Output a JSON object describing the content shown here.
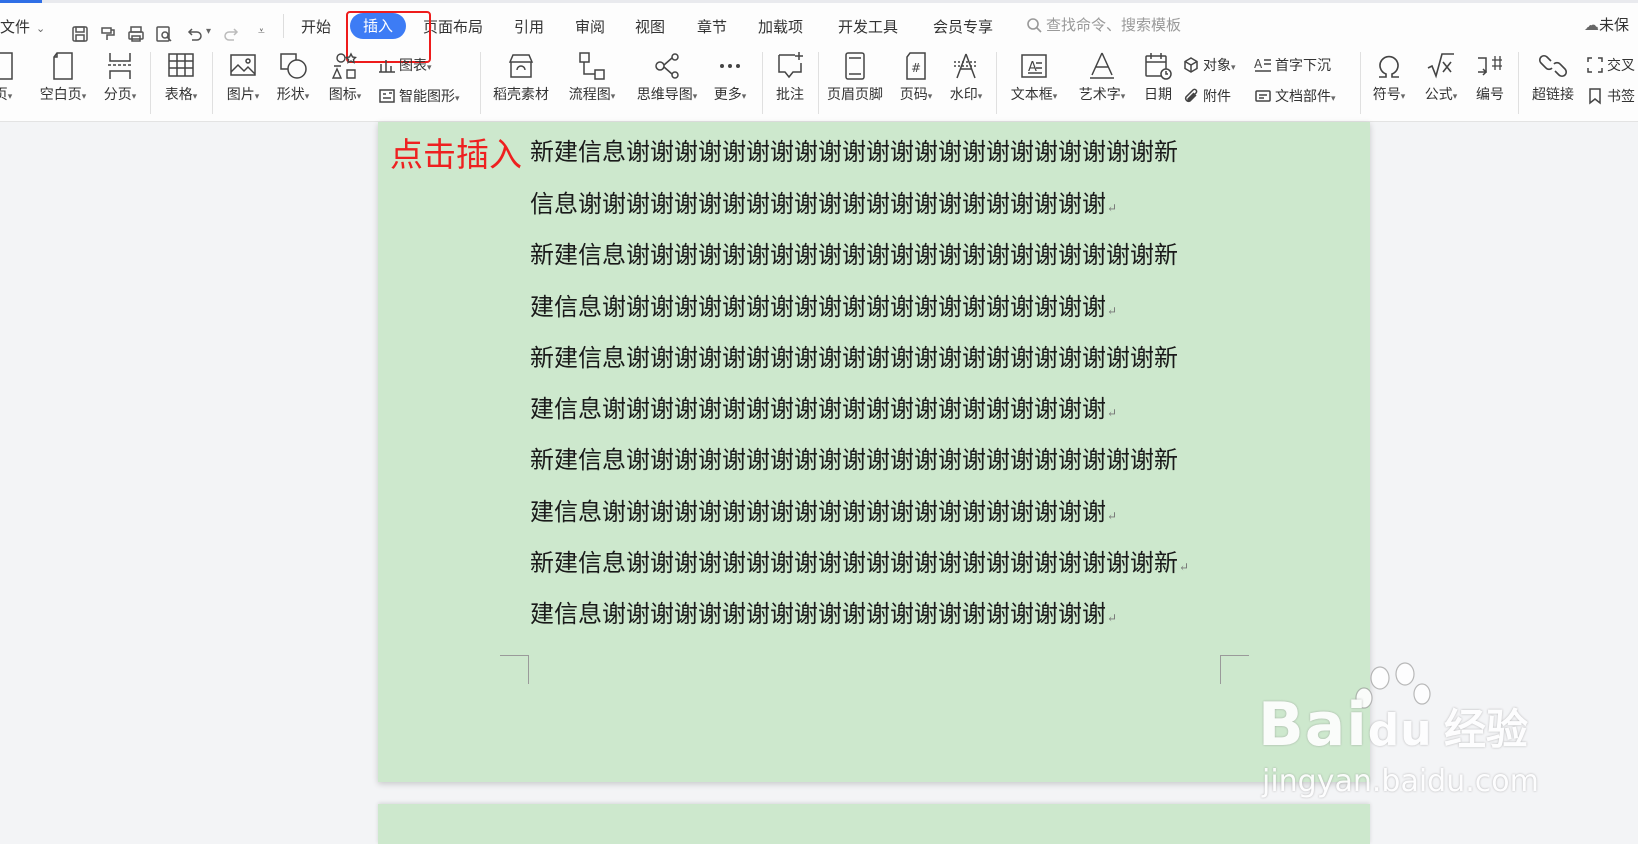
{
  "menu": {
    "file": "文件",
    "tabs": [
      "开始",
      "插入",
      "页面布局",
      "引用",
      "审阅",
      "视图",
      "章节",
      "加载项",
      "开发工具",
      "会员专享"
    ],
    "active_tab": "插入",
    "search_placeholder": "查找命令、搜索模板",
    "right_status": "未保"
  },
  "ribbon": {
    "cover_partial": "页",
    "blank_page": "空白页",
    "page_break": "分页",
    "table": "表格",
    "picture": "图片",
    "shape": "形状",
    "icon": "图标",
    "chart": "图表",
    "smart_shape": "智能图形",
    "shell_material": "稻壳素材",
    "flowchart": "流程图",
    "mindmap": "思维导图",
    "more": "更多",
    "comment": "批注",
    "header_footer": "页眉页脚",
    "page_number": "页码",
    "watermark": "水印",
    "text_box": "文本框",
    "word_art": "艺术字",
    "date": "日期",
    "object": "对象",
    "attachment": "附件",
    "drop_cap": "首字下沉",
    "doc_parts": "文档部件",
    "symbol": "符号",
    "formula": "公式",
    "numbering": "编号",
    "hyperlink": "超链接",
    "cross_ref_partial": "交叉",
    "bookmark": "书签"
  },
  "document": {
    "annotation": "点击插入",
    "lines": [
      "新建信息谢谢谢谢谢谢谢谢谢谢谢谢谢谢谢谢谢谢谢谢谢谢新",
      "信息谢谢谢谢谢谢谢谢谢谢谢谢谢谢谢谢谢谢谢谢谢谢",
      "新建信息谢谢谢谢谢谢谢谢谢谢谢谢谢谢谢谢谢谢谢谢谢谢新",
      "建信息谢谢谢谢谢谢谢谢谢谢谢谢谢谢谢谢谢谢谢谢谢",
      "新建信息谢谢谢谢谢谢谢谢谢谢谢谢谢谢谢谢谢谢谢谢谢谢新",
      "建信息谢谢谢谢谢谢谢谢谢谢谢谢谢谢谢谢谢谢谢谢谢",
      "新建信息谢谢谢谢谢谢谢谢谢谢谢谢谢谢谢谢谢谢谢谢谢谢新",
      "建信息谢谢谢谢谢谢谢谢谢谢谢谢谢谢谢谢谢谢谢谢谢",
      "新建信息谢谢谢谢谢谢谢谢谢谢谢谢谢谢谢谢谢谢谢谢谢谢新",
      "建信息谢谢谢谢谢谢谢谢谢谢谢谢谢谢谢谢谢谢谢谢谢"
    ]
  },
  "watermark": {
    "brand": "Bai",
    "brand2": "du",
    "jingyan": "经验",
    "url": "jingyan.baidu.com"
  },
  "colors": {
    "accent": "#3d7cf5",
    "highlight_box": "#ee1c1c",
    "page_bg": "#cde8cd"
  }
}
